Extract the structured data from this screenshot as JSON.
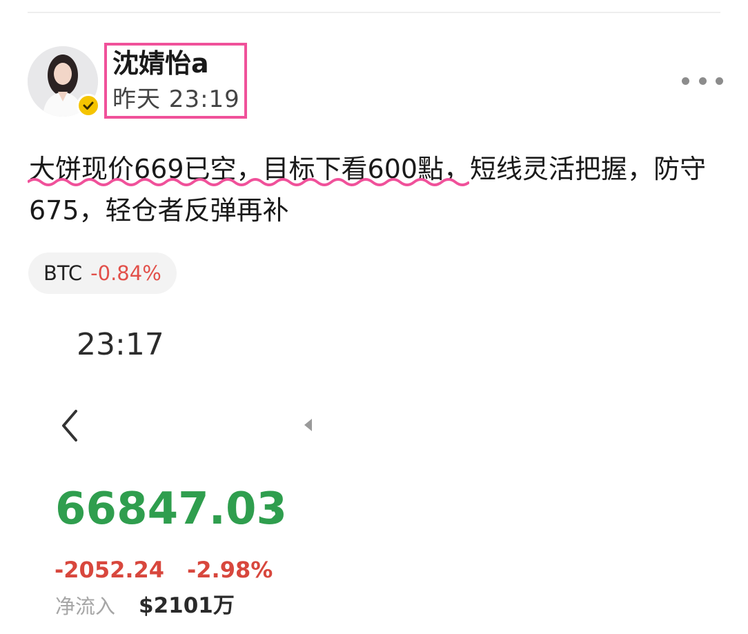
{
  "post": {
    "author_name": "沈婧怡a",
    "timestamp": "昨天 23:19",
    "text": "大饼现价669已空，目标下看600點，短线灵活把握，防守675，轻仓者反弹再补",
    "more_icon": "more-horizontal-icon"
  },
  "ticker": {
    "symbol": "BTC",
    "change": "-0.84%"
  },
  "embedded_screenshot": {
    "clock": "23:17",
    "price": "66847.03",
    "change_abs": "-2052.24",
    "change_pct": "-2.98%",
    "netflow_label": "净流入",
    "netflow_value": "$2101万"
  },
  "colors": {
    "highlight_border": "#f0519a",
    "verify_badge": "#f5c400",
    "price_green": "#2f9e4e",
    "change_red": "#d8473d"
  }
}
